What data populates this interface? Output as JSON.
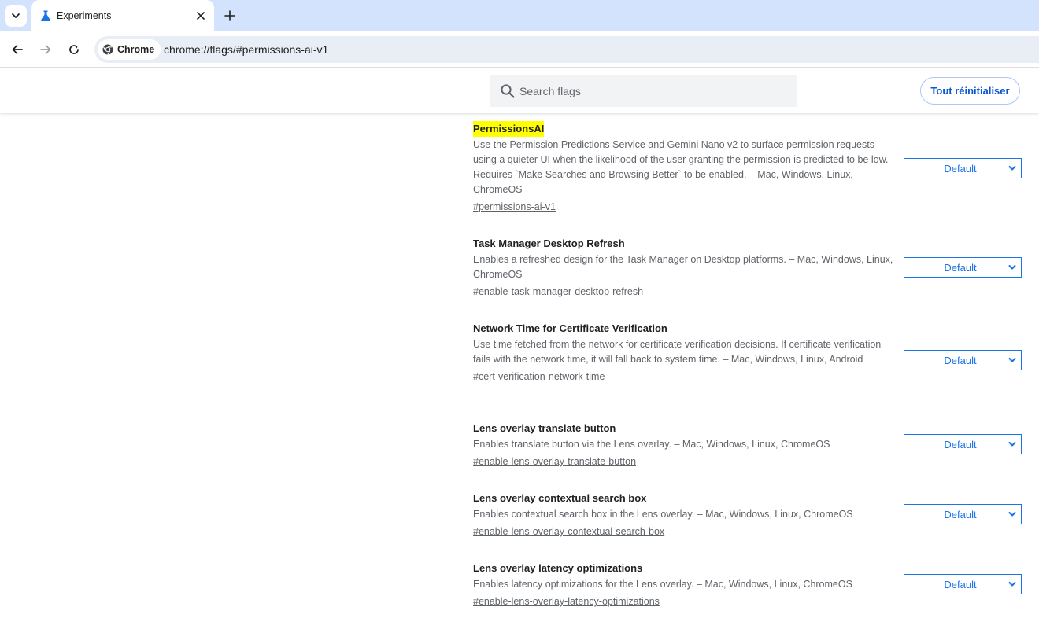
{
  "browser": {
    "tab": {
      "title": "Experiments"
    },
    "omnibox": {
      "chip_label": "Chrome",
      "url": "chrome://flags/#permissions-ai-v1"
    },
    "colors": {
      "tabstrip_bg": "#d3e3fd",
      "omnibox_bg": "#e9eef6",
      "accent": "#1a73e8"
    }
  },
  "header": {
    "search_placeholder": "Search flags",
    "reset_label": "Tout réinitialiser"
  },
  "experiments": [
    {
      "title": "PermissionsAI",
      "highlighted": true,
      "description": "Use the Permission Predictions Service and Gemini Nano v2 to surface permission requests using a quieter UI when the likelihood of the user granting the permission is predicted to be low. Requires `Make Searches and Browsing Better` to be enabled. – Mac, Windows, Linux, ChromeOS",
      "link": "#permissions-ai-v1",
      "value": "Default"
    },
    {
      "title": "Task Manager Desktop Refresh",
      "highlighted": false,
      "description": "Enables a refreshed design for the Task Manager on Desktop platforms. – Mac, Windows, Linux, ChromeOS",
      "link": "#enable-task-manager-desktop-refresh",
      "value": "Default"
    },
    {
      "title": "Network Time for Certificate Verification",
      "highlighted": false,
      "description": "Use time fetched from the network for certificate verification decisions. If certificate verification fails with the network time, it will fall back to system time. – Mac, Windows, Linux, Android",
      "link": "#cert-verification-network-time",
      "value": "Default"
    },
    {
      "title": "Lens overlay translate button",
      "highlighted": false,
      "description": "Enables translate button via the Lens overlay. – Mac, Windows, Linux, ChromeOS",
      "link": "#enable-lens-overlay-translate-button",
      "value": "Default"
    },
    {
      "title": "Lens overlay contextual search box",
      "highlighted": false,
      "description": "Enables contextual search box in the Lens overlay. – Mac, Windows, Linux, ChromeOS",
      "link": "#enable-lens-overlay-contextual-search-box",
      "value": "Default"
    },
    {
      "title": "Lens overlay latency optimizations",
      "highlighted": false,
      "description": "Enables latency optimizations for the Lens overlay. – Mac, Windows, Linux, ChromeOS",
      "link": "#enable-lens-overlay-latency-optimizations",
      "value": "Default"
    }
  ]
}
